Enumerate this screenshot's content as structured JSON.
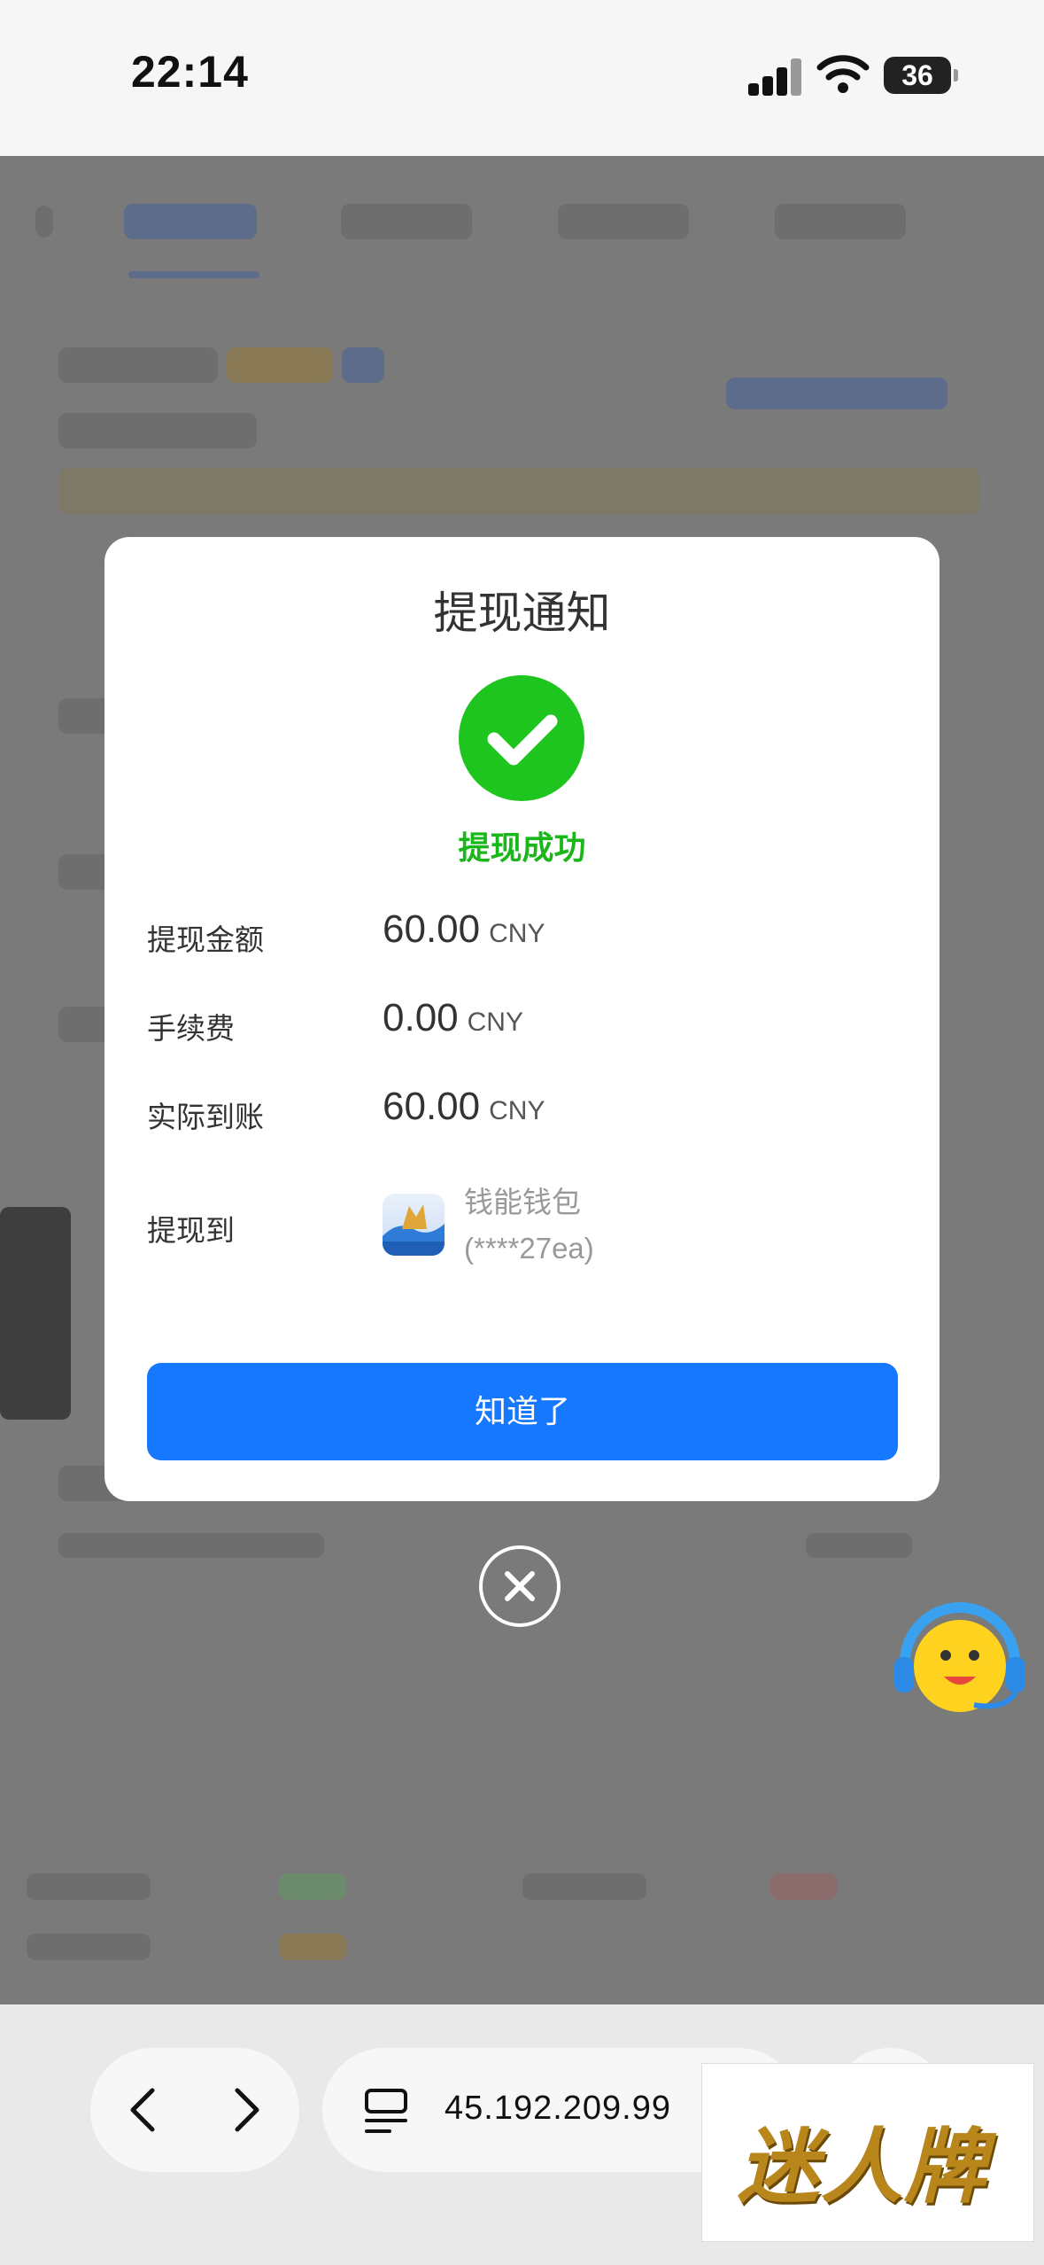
{
  "status_bar": {
    "time": "22:14",
    "battery": "36"
  },
  "dialog": {
    "title": "提现通知",
    "success_text": "提现成功",
    "rows": [
      {
        "label": "提现金额",
        "amount": "60.00",
        "unit": "CNY"
      },
      {
        "label": "手续费",
        "amount": "0.00",
        "unit": "CNY"
      },
      {
        "label": "实际到账",
        "amount": "60.00",
        "unit": "CNY"
      }
    ],
    "destination": {
      "label": "提现到",
      "wallet_name": "钱能钱包",
      "wallet_id": "(****27ea)",
      "icon_caption": "钱能钱包"
    },
    "ok_button": "知道了"
  },
  "browser": {
    "url": "45.192.209.99"
  },
  "watermark": "迷人牌",
  "colors": {
    "accent": "#1677ff",
    "success": "#1ec51e",
    "success_text": "#19b719"
  }
}
